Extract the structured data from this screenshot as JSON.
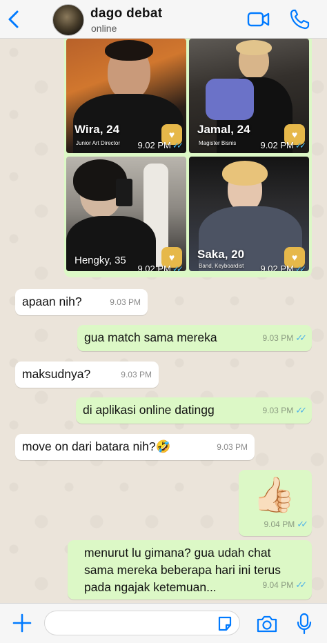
{
  "header": {
    "contact_name": "dago debat",
    "status": "online"
  },
  "profiles": [
    {
      "name": "Wira, 24",
      "subtitle": "Junior Art Director",
      "time": "9.02 PM"
    },
    {
      "name": "Jamal, 24",
      "subtitle": "Magister Bisnis",
      "time": "9.02 PM"
    },
    {
      "name": "Hengky, 35",
      "subtitle": "",
      "time": "9.02 PM"
    },
    {
      "name": "Saka, 20",
      "subtitle": "Band, Keyboardist",
      "time": "9.02 PM"
    }
  ],
  "messages": [
    {
      "direction": "in",
      "text": "apaan nih?",
      "time": "9.03 PM"
    },
    {
      "direction": "out",
      "text": "gua match sama mereka",
      "time": "9.03 PM"
    },
    {
      "direction": "in",
      "text": "maksudnya?",
      "time": "9.03 PM"
    },
    {
      "direction": "out",
      "text": "di aplikasi online datingg",
      "time": "9.03 PM"
    },
    {
      "direction": "in",
      "text": "move on dari batara nih?🤣",
      "time": "9.03 PM"
    },
    {
      "direction": "out",
      "text": "👍🏻",
      "time": "9.04 PM"
    },
    {
      "direction": "out",
      "text": "menurut lu gimana? gua udah chat sama mereka beberapa hari ini terus pada ngajak ketemuan...",
      "time": "9.04 PM"
    }
  ],
  "read_receipt": "✓✓",
  "composer": {
    "placeholder": ""
  },
  "colors": {
    "accent": "#007aff",
    "incoming_bubble": "#ffffff",
    "outgoing_bubble": "#dcf8c6",
    "read_tick": "#4fb3e8",
    "badge": "#e6b84a"
  },
  "icons": [
    "back-chevron-icon",
    "video-call-icon",
    "phone-icon",
    "plus-icon",
    "sticker-icon",
    "camera-icon",
    "microphone-icon",
    "heart-badge-icon"
  ]
}
